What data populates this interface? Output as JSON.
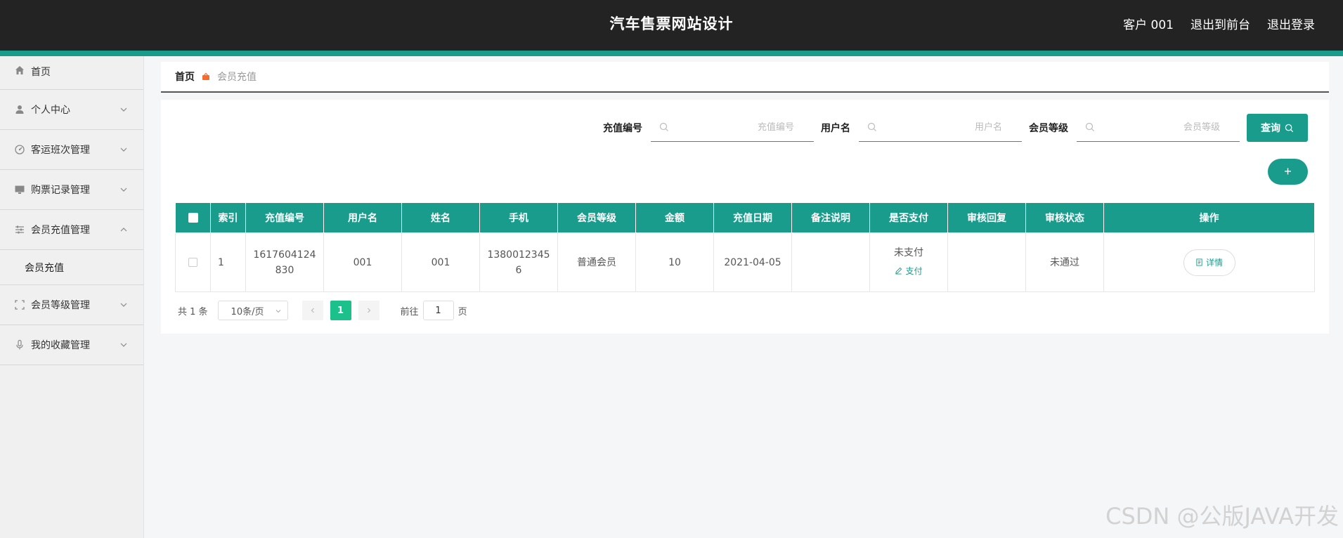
{
  "header": {
    "title": "汽车售票网站设计",
    "user": "客户 001",
    "to_front": "退出到前台",
    "logout": "退出登录"
  },
  "sidebar": {
    "items": [
      {
        "label": "首页",
        "icon": "home-icon"
      },
      {
        "label": "个人中心",
        "icon": "user-icon"
      },
      {
        "label": "客运班次管理",
        "icon": "dashboard-icon"
      },
      {
        "label": "购票记录管理",
        "icon": "monitor-icon"
      },
      {
        "label": "会员充值管理",
        "icon": "sliders-icon"
      },
      {
        "label": "会员等级管理",
        "icon": "fullscreen-icon"
      },
      {
        "label": "我的收藏管理",
        "icon": "microphone-icon"
      }
    ],
    "submenu": "会员充值"
  },
  "breadcrumb": {
    "home": "首页",
    "current": "会员充值"
  },
  "filters": {
    "recharge_no_label": "充值编号",
    "recharge_no_placeholder": "充值编号",
    "username_label": "用户名",
    "username_placeholder": "用户名",
    "level_label": "会员等级",
    "level_placeholder": "会员等级",
    "query": "查询",
    "add": "+"
  },
  "table": {
    "headers": [
      "索引",
      "充值编号",
      "用户名",
      "姓名",
      "手机",
      "会员等级",
      "金额",
      "充值日期",
      "备注说明",
      "是否支付",
      "审核回复",
      "审核状态",
      "操作"
    ],
    "rows": [
      {
        "index": "1",
        "recharge_no": "1617604124830",
        "username": "001",
        "name": "001",
        "phone": "13800123456",
        "level": "普通会员",
        "amount": "10",
        "date": "2021-04-05",
        "note": "",
        "paid": "未支付",
        "pay_action": "支付",
        "reply": "",
        "status": "未通过",
        "detail": "详情"
      }
    ]
  },
  "pager": {
    "total": "共 1 条",
    "page_size": "10条/页",
    "current_page": "1",
    "goto_prefix": "前往",
    "goto_value": "1",
    "goto_suffix": "页"
  },
  "watermark": "CSDN @公版JAVA开发",
  "colors": {
    "accent": "#1a9c8c",
    "topbar": "#232323",
    "page_active": "#1cc08a"
  }
}
